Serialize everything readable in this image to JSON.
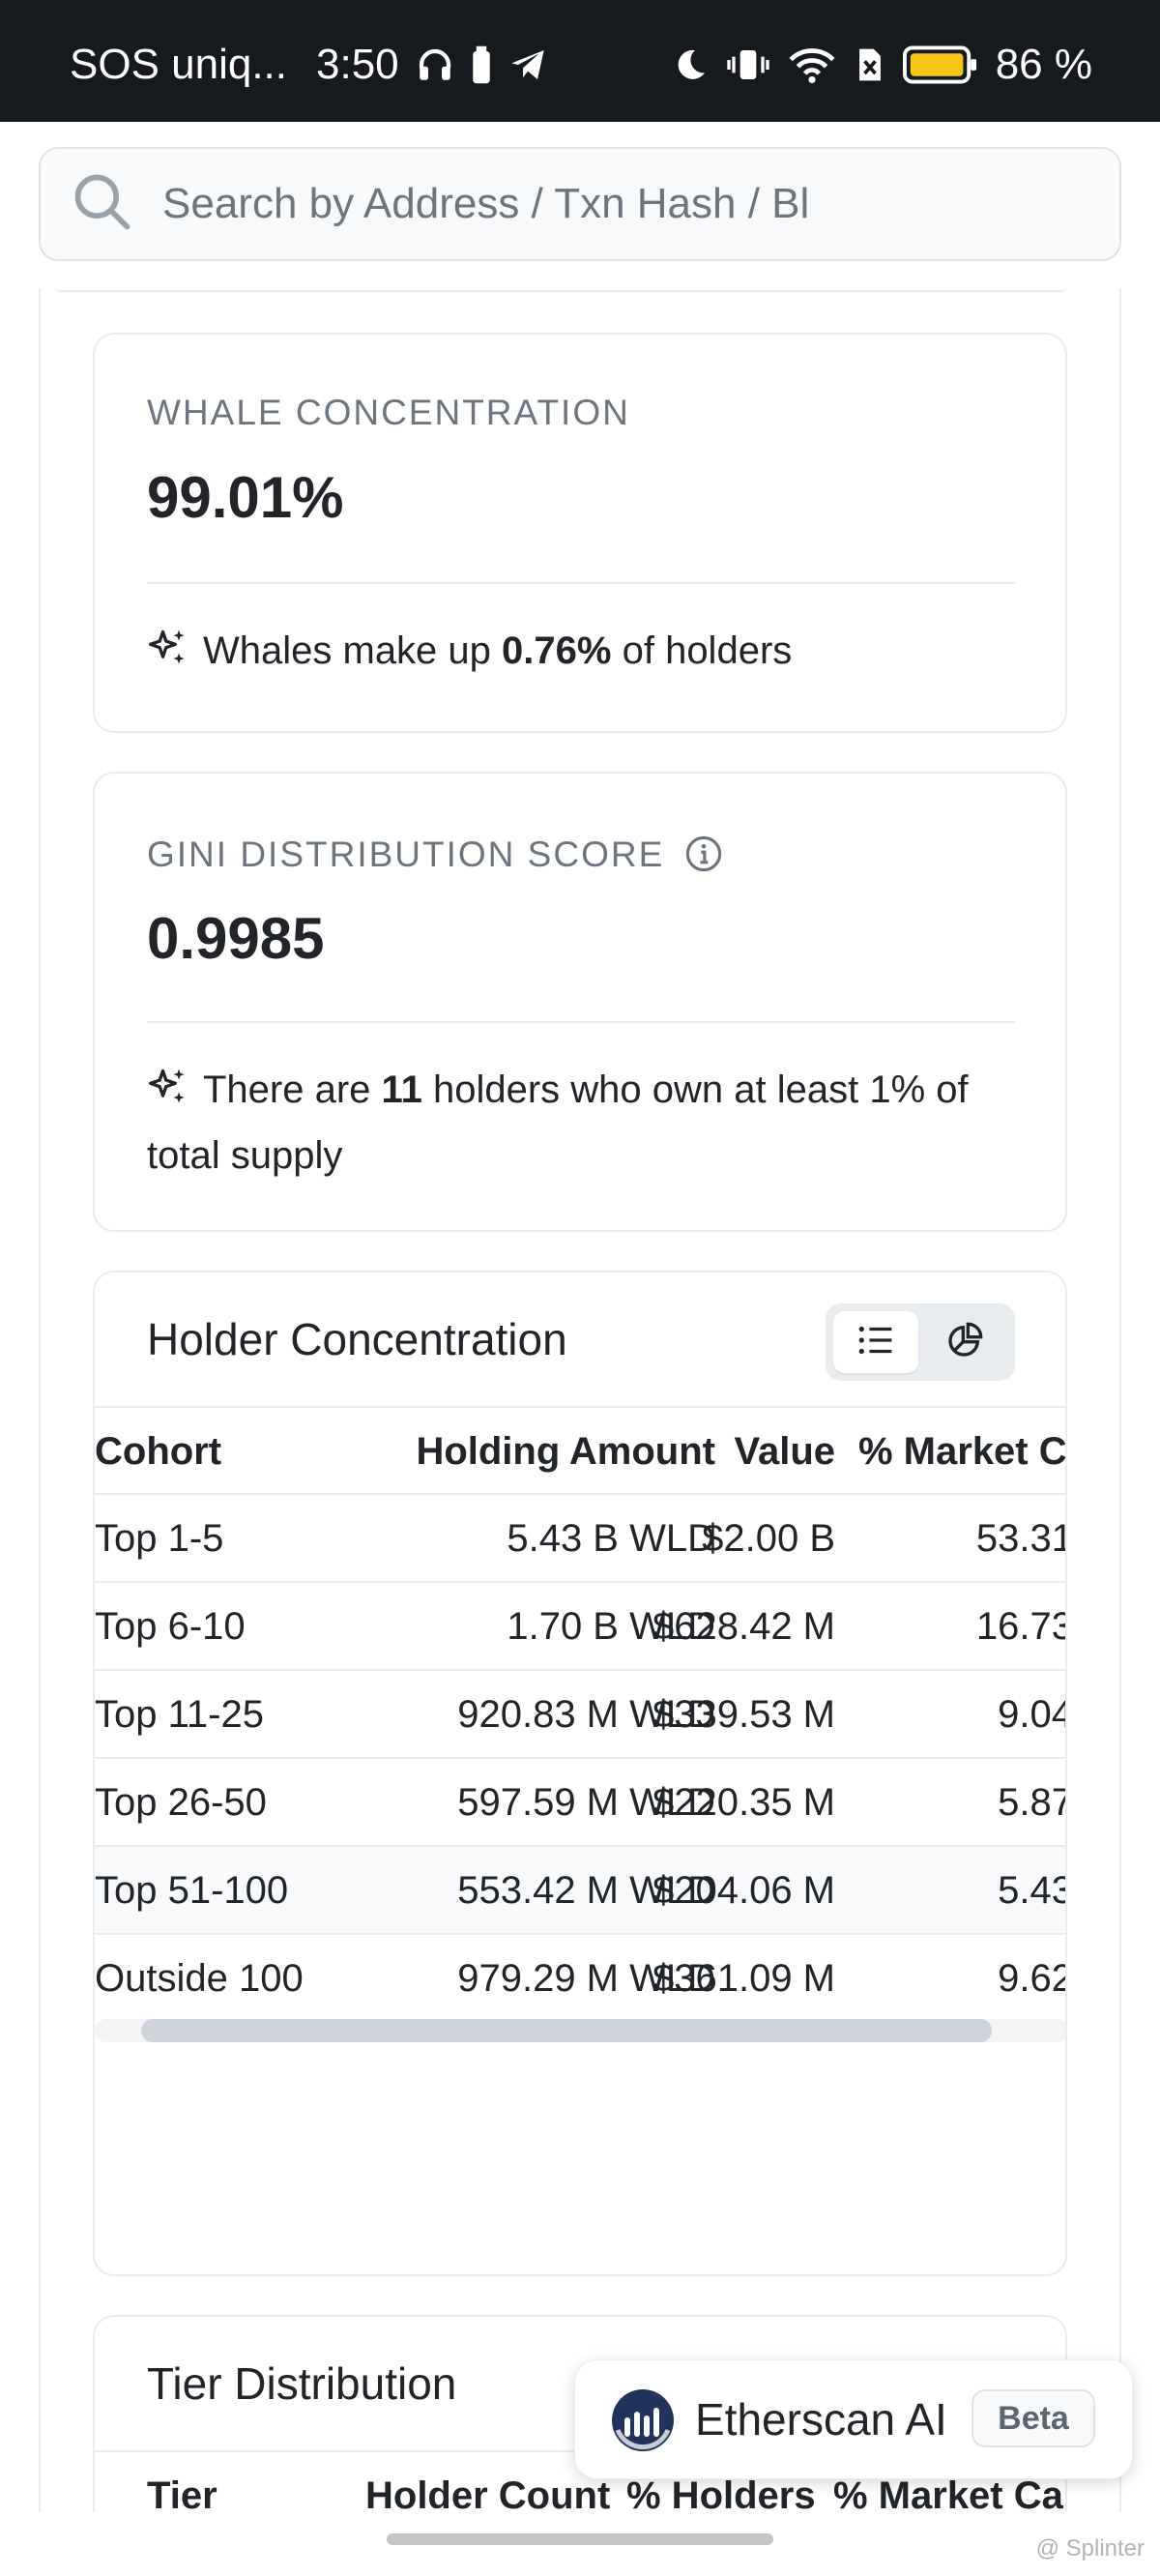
{
  "status_bar": {
    "carrier": "SOS uniq...",
    "time": "3:50",
    "battery": "86 %"
  },
  "search": {
    "placeholder": "Search by Address / Txn Hash / Bl"
  },
  "whale_card": {
    "label": "WHALE CONCENTRATION",
    "value": "99.01%",
    "note_prefix": "Whales make up",
    "note_bold": "0.76%",
    "note_suffix": "of holders"
  },
  "gini_card": {
    "label": "GINI DISTRIBUTION SCORE",
    "value": "0.9985",
    "note_prefix": "There are",
    "note_bold": "11",
    "note_suffix": "holders who own at least 1% of total supply"
  },
  "holder_concentration": {
    "title": "Holder Concentration",
    "columns": [
      "Cohort",
      "Holding Amount",
      "Value",
      "% Market Ca"
    ],
    "rows": [
      {
        "cohort": "Top 1-5",
        "amount": "5.43 B WLD",
        "value": "$2.00 B",
        "pct": "53.31"
      },
      {
        "cohort": "Top 6-10",
        "amount": "1.70 B WLD",
        "value": "$628.42 M",
        "pct": "16.73"
      },
      {
        "cohort": "Top 11-25",
        "amount": "920.83 M WLD",
        "value": "$339.53 M",
        "pct": "9.04"
      },
      {
        "cohort": "Top 26-50",
        "amount": "597.59 M WLD",
        "value": "$220.35 M",
        "pct": "5.87"
      },
      {
        "cohort": "Top 51-100",
        "amount": "553.42 M WLD",
        "value": "$204.06 M",
        "pct": "5.43"
      },
      {
        "cohort": "Outside 100",
        "amount": "979.29 M WLD",
        "value": "$361.09 M",
        "pct": "9.62"
      }
    ]
  },
  "tier_distribution": {
    "title": "Tier Distribution",
    "columns": [
      "Tier",
      "Holder Count",
      "% Holders",
      "% Market Cap"
    ]
  },
  "ai_assistant": {
    "label": "Etherscan AI",
    "badge": "Beta"
  },
  "watermark": "@ Splinter",
  "colors": {
    "status_bar_bg": "#16191d",
    "battery_fill": "#f5c518",
    "ai_logo": "#21325b"
  }
}
